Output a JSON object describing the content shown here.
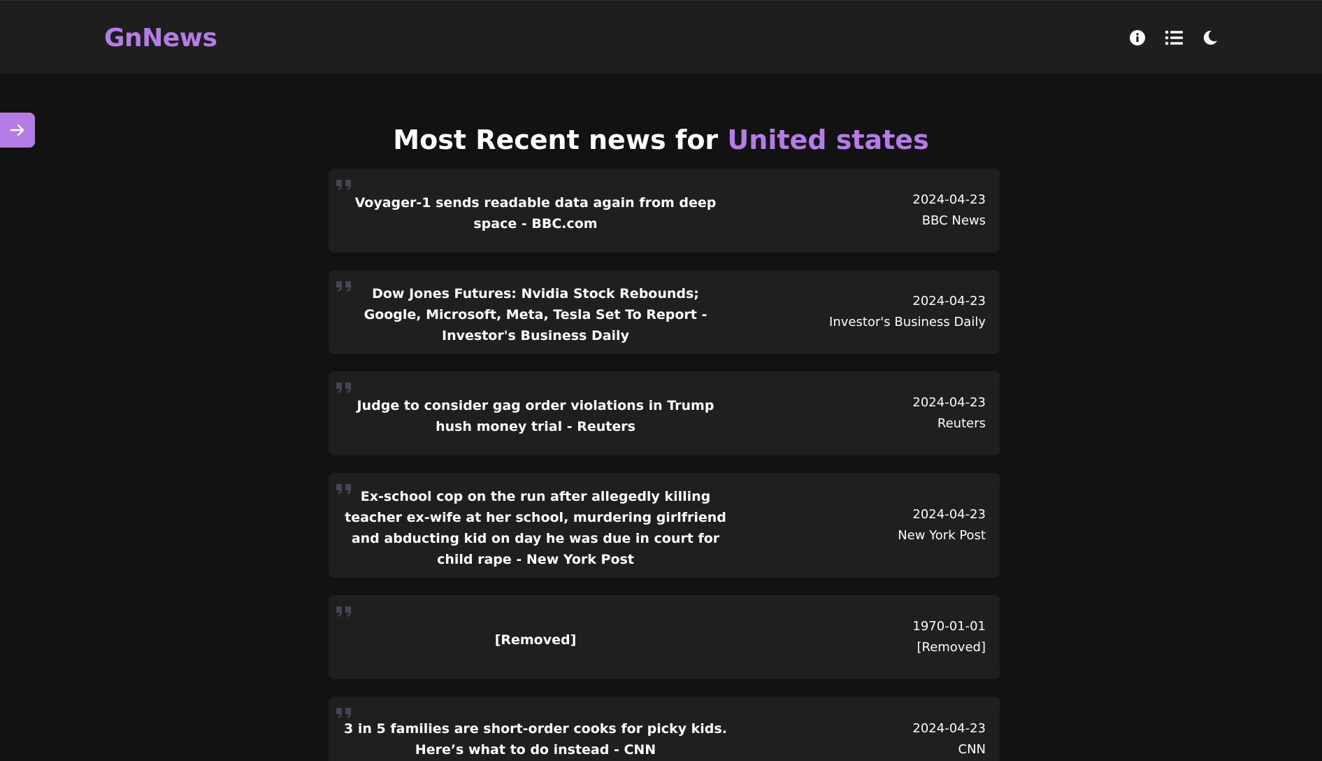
{
  "app": {
    "logo": "GnNews"
  },
  "header": {
    "icons": [
      "info-icon",
      "list-icon",
      "moon-icon"
    ]
  },
  "sidebar_toggle": {
    "icon": "arrow-right-icon"
  },
  "page": {
    "heading_prefix": "Most Recent news for",
    "heading_country": "United states"
  },
  "colors": {
    "accent": "#b57ce8",
    "background": "#121212",
    "card": "#1f1f1f",
    "topbar": "#1e1e1e"
  },
  "articles": [
    {
      "title": "Voyager-1 sends readable data again from deep space - BBC.com",
      "date": "2024-04-23",
      "source": "BBC News"
    },
    {
      "title": "Dow Jones Futures: Nvidia Stock Rebounds; Google, Microsoft, Meta, Tesla Set To Report - Investor's Business Daily",
      "date": "2024-04-23",
      "source": "Investor's Business Daily"
    },
    {
      "title": "Judge to consider gag order violations in Trump hush money trial - Reuters",
      "date": "2024-04-23",
      "source": "Reuters"
    },
    {
      "title": "Ex-school cop on the run after allegedly killing teacher ex-wife at her school, murdering girlfriend and abducting kid on day he was due in court for child rape - New York Post",
      "date": "2024-04-23",
      "source": "New York Post"
    },
    {
      "title": "[Removed]",
      "date": "1970-01-01",
      "source": "[Removed]"
    },
    {
      "title": "3 in 5 families are short-order cooks for picky kids. Here’s what to do instead - CNN",
      "date": "2024-04-23",
      "source": "CNN"
    }
  ]
}
